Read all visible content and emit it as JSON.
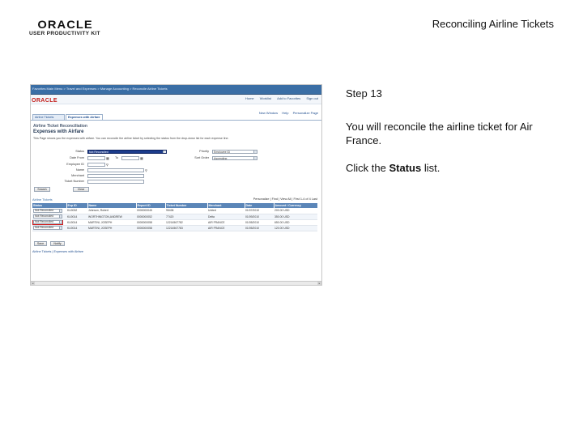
{
  "header": {
    "logo_text": "ORACLE",
    "logo_subtext": "USER PRODUCTIVITY KIT",
    "title": "Reconciling Airline Tickets"
  },
  "screenshot": {
    "breadcrumb": "Favorites   Main Menu  >  Travel and Expenses  >  Manage Accounting  >  Reconcile Airline Tickets",
    "header_logo": "ORACLE",
    "header_links": [
      "Home",
      "Worklist",
      "Add to Favorites",
      "Sign out"
    ],
    "top_links": [
      "New Window",
      "Help",
      "Personalize Page"
    ],
    "tabs": [
      "Airline Tickets",
      "Expenses with Airfare"
    ],
    "page_title": "Airline Ticket Reconciliation",
    "page_subtitle": "Expenses with Airfare",
    "page_description": "This Page shows you the expenses with airfare. You can reconcile the airline ticket by selecting the status from the drop-down list for each expense line.",
    "fields": {
      "status_label": "Status",
      "status_value": "Not Reconciled",
      "date_from_label": "Date From",
      "to_label": "To",
      "employee_label": "Employee ID",
      "name_label": "Name",
      "merchant_label": "Merchant",
      "ticket_label": "Ticket Number",
      "priority_label": "Priority",
      "priority_value": "Employee ID",
      "sort_label": "Sort Order",
      "sort_value": "Ascending"
    },
    "buttons": {
      "search": "Search",
      "clear": "Clear",
      "save": "Save",
      "notify": "Notify"
    },
    "results": {
      "title": "Airline Tickets",
      "pager": "Personalize | Find | View All |      First  1-4 of 4  Last",
      "columns": [
        "Status",
        "Exp ID",
        "Name",
        "Report ID",
        "Ticket Number",
        "Merchant",
        "Date",
        "Amount / Currency"
      ],
      "rows": [
        [
          "Not Reconciled",
          "KU0032",
          "Johnson, Robert",
          "0000000045",
          "95438",
          "United",
          "01/07/2010",
          "200.00 USD"
        ],
        [
          "Not Reconciled",
          "KU0014",
          "WORTHINGTON,ANDREW",
          "0000000052",
          "77420",
          "Delta",
          "01/09/2010",
          "350.00 USD"
        ],
        [
          "Not Reconciled",
          "KU0014",
          "MARTINI, JOSEPH",
          "0000000058",
          "12214567782",
          "AIR FRANCE",
          "01/05/2010",
          "650.00 USD"
        ],
        [
          "Not Reconciled",
          "KU0014",
          "MARTINI, JOSEPH",
          "0000000058",
          "12214567783",
          "AIR FRANCE",
          "01/05/2010",
          "120.00 USD"
        ]
      ]
    },
    "footer_links": "Airline Tickets  |  Expenses with Airfare"
  },
  "instructions": {
    "step": "Step 13",
    "text": "You will reconcile the airline ticket for Air France.",
    "action_prefix": "Click the ",
    "action_bold": "Status",
    "action_suffix": " list."
  }
}
